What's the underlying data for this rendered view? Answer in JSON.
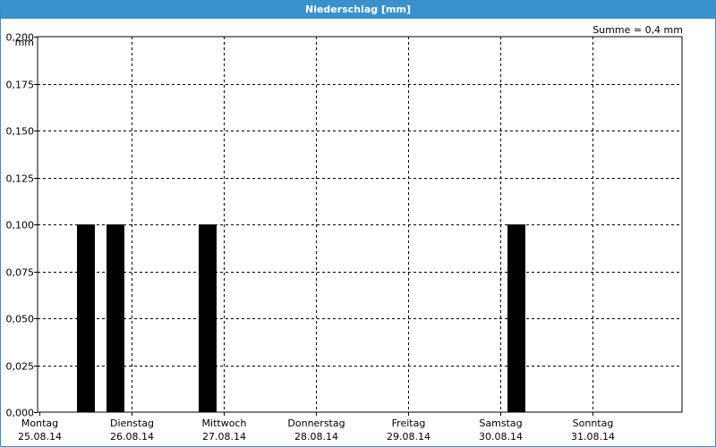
{
  "window": {
    "title": "Niederschlag [mm]"
  },
  "chart_data": {
    "type": "bar",
    "title": "Niederschlag [mm]",
    "unit_label": "mm",
    "summary": "Summe = 0,4 mm",
    "ylim": [
      0,
      0.2
    ],
    "yticks": [
      "0,000",
      "0,025",
      "0,050",
      "0,075",
      "0,100",
      "0,125",
      "0,150",
      "0,175",
      "0,200"
    ],
    "ytick_values": [
      0,
      0.025,
      0.05,
      0.075,
      0.1,
      0.125,
      0.15,
      0.175,
      0.2
    ],
    "days": [
      {
        "weekday": "Montag",
        "date": "25.08.14"
      },
      {
        "weekday": "Dienstag",
        "date": "26.08.14"
      },
      {
        "weekday": "Mittwoch",
        "date": "27.08.14"
      },
      {
        "weekday": "Donnerstag",
        "date": "28.08.14"
      },
      {
        "weekday": "Freitag",
        "date": "29.08.14"
      },
      {
        "weekday": "Samstag",
        "date": "30.08.14"
      },
      {
        "weekday": "Sonntag",
        "date": "31.08.14"
      }
    ],
    "bars": [
      {
        "day": 0,
        "fraction": 0.5,
        "value": 0.1
      },
      {
        "day": 0,
        "fraction": 0.83,
        "value": 0.1
      },
      {
        "day": 1,
        "fraction": 0.83,
        "value": 0.1
      },
      {
        "day": 5,
        "fraction": 0.17,
        "value": 0.1
      }
    ],
    "grid": true,
    "bar_color": "#000000"
  }
}
